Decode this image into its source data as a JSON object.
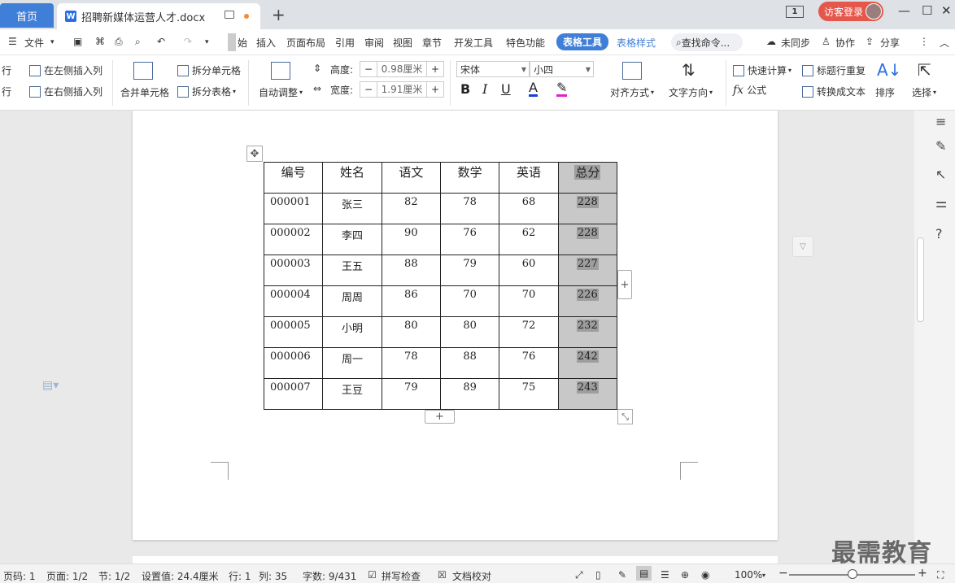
{
  "titlebar": {
    "home_tab": "首页",
    "doc_tab": "招聘新媒体运营人才.docx",
    "doc_icon": "W",
    "new_tab": "+",
    "page_badge": "1",
    "login": "访客登录",
    "minimize": "—",
    "maximize": "☐",
    "close": "✕"
  },
  "menubar": {
    "menu_icon": "☰",
    "file": "文件",
    "items": [
      "始",
      "插入",
      "页面布局",
      "引用",
      "审阅",
      "视图",
      "章节",
      "开发工具",
      "特色功能"
    ],
    "active": "表格工具",
    "table_style": "表格样式",
    "search": "查找命令...",
    "sync": "未同步",
    "collab": "协作",
    "share": "分享",
    "more": "⋮",
    "collapse": "︿"
  },
  "ribbon": {
    "ins_row_above": "行",
    "ins_row_below": "行",
    "ins_col_left": "在左侧插入列",
    "ins_col_right": "在右侧插入列",
    "merge": "合并单元格",
    "split_cell": "拆分单元格",
    "split_table": "拆分表格",
    "autofit": "自动调整",
    "height_label": "高度:",
    "height_value": "0.98厘米",
    "width_label": "宽度:",
    "width_value": "1.91厘米",
    "minus": "−",
    "plus": "+",
    "font_name": "宋体",
    "font_size": "小四",
    "bold": "B",
    "italic": "I",
    "underline": "U",
    "font_color": "A",
    "highlight": "✎",
    "align": "对齐方式",
    "text_dir": "文字方向",
    "quick_calc": "快速计算",
    "formula_fx": "fx",
    "formula": "公式",
    "repeat_header": "标题行重复",
    "to_text": "转换成文本",
    "sort": "排序",
    "select": "选择"
  },
  "table": {
    "headers": [
      "编号",
      "姓名",
      "语文",
      "数学",
      "英语",
      "总分"
    ],
    "rows": [
      [
        "000001",
        "张三",
        "82",
        "78",
        "68",
        "228"
      ],
      [
        "000002",
        "李四",
        "90",
        "76",
        "62",
        "228"
      ],
      [
        "000003",
        "王五",
        "88",
        "79",
        "60",
        "227"
      ],
      [
        "000004",
        "周周",
        "86",
        "70",
        "70",
        "226"
      ],
      [
        "000005",
        "小明",
        "80",
        "80",
        "72",
        "232"
      ],
      [
        "000006",
        "周一",
        "78",
        "88",
        "76",
        "242"
      ],
      [
        "000007",
        "王豆",
        "79",
        "89",
        "75",
        "243"
      ]
    ],
    "move_handle": "✥",
    "add_col": "+",
    "add_row": "+",
    "resize": "⤡"
  },
  "statusbar": {
    "page_num": "页码: 1",
    "pages": "页面: 1/2",
    "section": "节: 1/2",
    "setting": "设置值: 24.4厘米",
    "row": "行: 1",
    "col": "列: 35",
    "chars": "字数: 9/431",
    "spell": "拼写检查",
    "proof": "文档校对",
    "zoom": "100%",
    "zoom_minus": "−",
    "zoom_plus": "+"
  },
  "watermark": "最需教育",
  "colors": {
    "accent": "#3f7fd8",
    "login": "#e5574a",
    "selection": "#c8c8c8"
  }
}
